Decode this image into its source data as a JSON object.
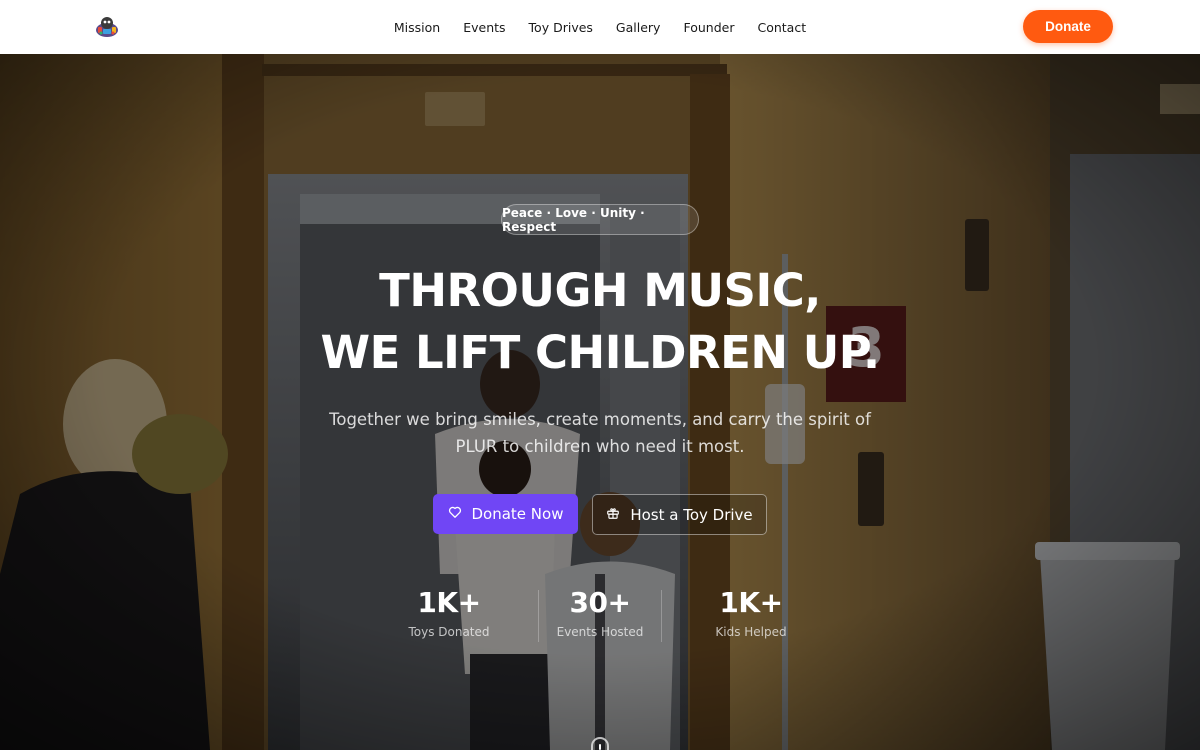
{
  "nav": {
    "logo_icon": "plur-toy-logo-icon",
    "links": [
      "Mission",
      "Events",
      "Toy Drives",
      "Gallery",
      "Founder",
      "Contact"
    ],
    "donate_label": "Donate"
  },
  "hero": {
    "tagline": "Peace · Love · Unity · Respect",
    "headline_line1": "THROUGH MUSIC,",
    "headline_line2": "WE LIFT CHILDREN UP.",
    "subtitle": "Together we bring smiles, create moments, and carry the spirit of PLUR to children who need it most.",
    "primary_cta": {
      "label": "Donate Now",
      "icon": "heart-icon"
    },
    "secondary_cta": {
      "label": "Host a Toy Drive",
      "icon": "gift-icon"
    },
    "stats": [
      {
        "value": "1K+",
        "label": "Toys Donated"
      },
      {
        "value": "30+",
        "label": "Events Hosted"
      },
      {
        "value": "1K+",
        "label": "Kids Helped"
      }
    ],
    "scroll_icon": "mouse-scroll-icon"
  },
  "colors": {
    "accent_orange": "#ff5a10",
    "accent_purple": "#7046f5"
  }
}
